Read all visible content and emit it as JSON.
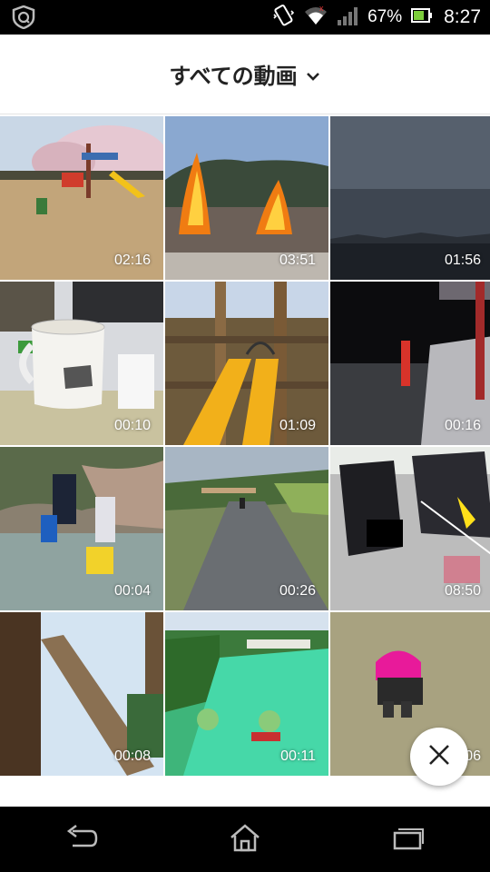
{
  "status_bar": {
    "battery_percent": "67%",
    "time": "8:27",
    "icons": [
      "shield-app-icon",
      "vibrate-icon",
      "wifi-icon",
      "signal-icon",
      "battery-icon"
    ]
  },
  "header": {
    "title": "すべての動画",
    "dropdown_icon": "chevron-down-icon"
  },
  "videos": [
    {
      "duration": "02:16"
    },
    {
      "duration": "03:51"
    },
    {
      "duration": "01:56"
    },
    {
      "duration": "00:10"
    },
    {
      "duration": "01:09"
    },
    {
      "duration": "00:16"
    },
    {
      "duration": "00:04"
    },
    {
      "duration": "00:26"
    },
    {
      "duration": "08:50"
    },
    {
      "duration": "00:08"
    },
    {
      "duration": "00:11"
    },
    {
      "duration": "00:06"
    }
  ],
  "fab": {
    "icon": "close-icon"
  },
  "nav_bar": {
    "icons": [
      "back-icon",
      "home-icon",
      "recent-apps-icon"
    ]
  }
}
